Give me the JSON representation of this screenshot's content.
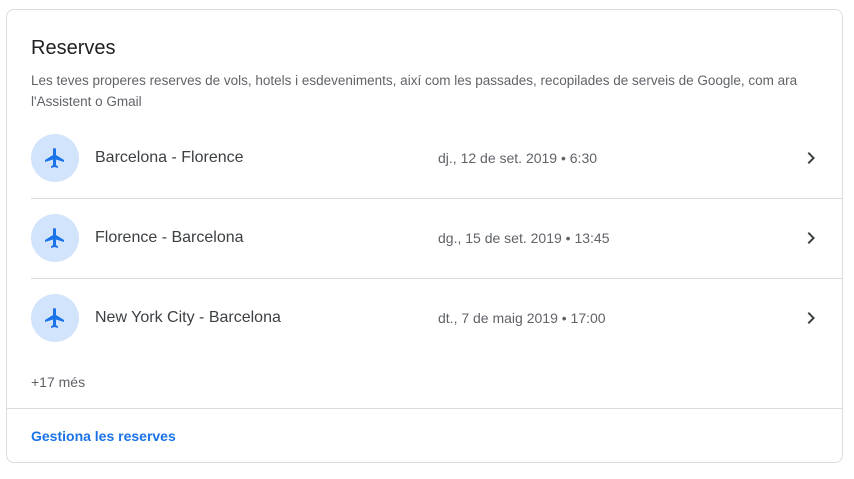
{
  "card": {
    "title": "Reserves",
    "subtitle": "Les teves properes reserves de vols, hotels i esdeveniments, així com les passades, recopilades de serveis de Google, com ara l'Assistent o Gmail"
  },
  "reservations": [
    {
      "icon": "airplane-icon",
      "route": "Barcelona - Florence",
      "date": "dj., 12 de set. 2019 • 6:30"
    },
    {
      "icon": "airplane-icon",
      "route": "Florence - Barcelona",
      "date": "dg., 15 de set. 2019 • 13:45"
    },
    {
      "icon": "airplane-icon",
      "route": "New York City - Barcelona",
      "date": "dt., 7 de maig 2019 • 17:00"
    }
  ],
  "more_label": "+17 més",
  "manage_label": "Gestiona les reserves",
  "colors": {
    "accent": "#1a73e8",
    "icon_bg": "#d2e3fc",
    "divider": "#dadce0"
  }
}
